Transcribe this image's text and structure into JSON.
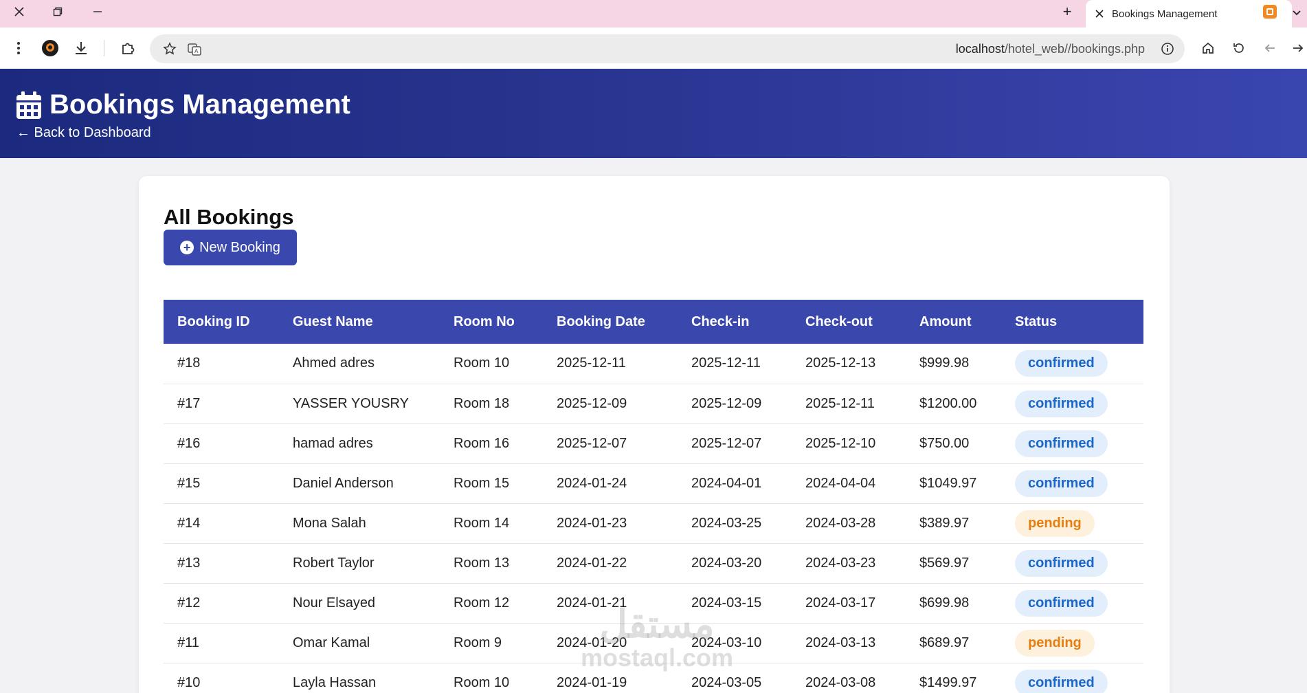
{
  "browser": {
    "tab_title": "Bookings Management",
    "new_tab_symbol": "+",
    "url_host": "localhost",
    "url_path": "/hotel_web//bookings.php"
  },
  "header": {
    "title": "Bookings Management",
    "back_link": "← Back to Dashboard"
  },
  "main": {
    "heading": "All Bookings",
    "new_booking_label": "New Booking",
    "table": {
      "columns": [
        "Booking ID",
        "Guest Name",
        "Room No",
        "Booking Date",
        "Check-in",
        "Check-out",
        "Amount",
        "Status"
      ],
      "rows": [
        {
          "id": "#18",
          "guest": "Ahmed adres",
          "room": "Room 10",
          "booking_date": "2025-12-11",
          "check_in": "2025-12-11",
          "check_out": "2025-12-13",
          "amount": "$999.98",
          "status": "confirmed"
        },
        {
          "id": "#17",
          "guest": "YASSER YOUSRY",
          "room": "Room 18",
          "booking_date": "2025-12-09",
          "check_in": "2025-12-09",
          "check_out": "2025-12-11",
          "amount": "$1200.00",
          "status": "confirmed"
        },
        {
          "id": "#16",
          "guest": "hamad adres",
          "room": "Room 16",
          "booking_date": "2025-12-07",
          "check_in": "2025-12-07",
          "check_out": "2025-12-10",
          "amount": "$750.00",
          "status": "confirmed"
        },
        {
          "id": "#15",
          "guest": "Daniel Anderson",
          "room": "Room 15",
          "booking_date": "2024-01-24",
          "check_in": "2024-04-01",
          "check_out": "2024-04-04",
          "amount": "$1049.97",
          "status": "confirmed"
        },
        {
          "id": "#14",
          "guest": "Mona Salah",
          "room": "Room 14",
          "booking_date": "2024-01-23",
          "check_in": "2024-03-25",
          "check_out": "2024-03-28",
          "amount": "$389.97",
          "status": "pending"
        },
        {
          "id": "#13",
          "guest": "Robert Taylor",
          "room": "Room 13",
          "booking_date": "2024-01-22",
          "check_in": "2024-03-20",
          "check_out": "2024-03-23",
          "amount": "$569.97",
          "status": "confirmed"
        },
        {
          "id": "#12",
          "guest": "Nour Elsayed",
          "room": "Room 12",
          "booking_date": "2024-01-21",
          "check_in": "2024-03-15",
          "check_out": "2024-03-17",
          "amount": "$699.98",
          "status": "confirmed"
        },
        {
          "id": "#11",
          "guest": "Omar Kamal",
          "room": "Room 9",
          "booking_date": "2024-01-20",
          "check_in": "2024-03-10",
          "check_out": "2024-03-13",
          "amount": "$689.97",
          "status": "pending"
        },
        {
          "id": "#10",
          "guest": "Layla Hassan",
          "room": "Room 10",
          "booking_date": "2024-01-19",
          "check_in": "2024-03-05",
          "check_out": "2024-03-08",
          "amount": "$1499.97",
          "status": "confirmed"
        }
      ]
    }
  },
  "watermark": {
    "arabic": "مستقل",
    "latin": "mostaql.com"
  },
  "icons": {
    "close": "close-icon",
    "restore": "restore-icon",
    "minimize": "minimize-icon",
    "menu": "kebab-menu-icon",
    "profile": "profile-avatar-icon",
    "download": "download-icon",
    "extensions": "puzzle-icon",
    "star": "star-icon",
    "translate": "translate-icon",
    "site_info": "info-icon",
    "home": "home-icon",
    "reload": "reload-icon",
    "back": "back-arrow-icon",
    "forward": "forward-arrow-icon",
    "calendar": "calendar-icon"
  },
  "colors": {
    "header_start": "#1b2a7e",
    "header_end": "#3a46b0",
    "primary": "#3a47ad",
    "confirmed_text": "#1b66c9",
    "confirmed_bg": "#e2eefc",
    "pending_text": "#e57f12",
    "pending_bg": "#fdf0dc",
    "titlebar": "#f6d6e4"
  }
}
